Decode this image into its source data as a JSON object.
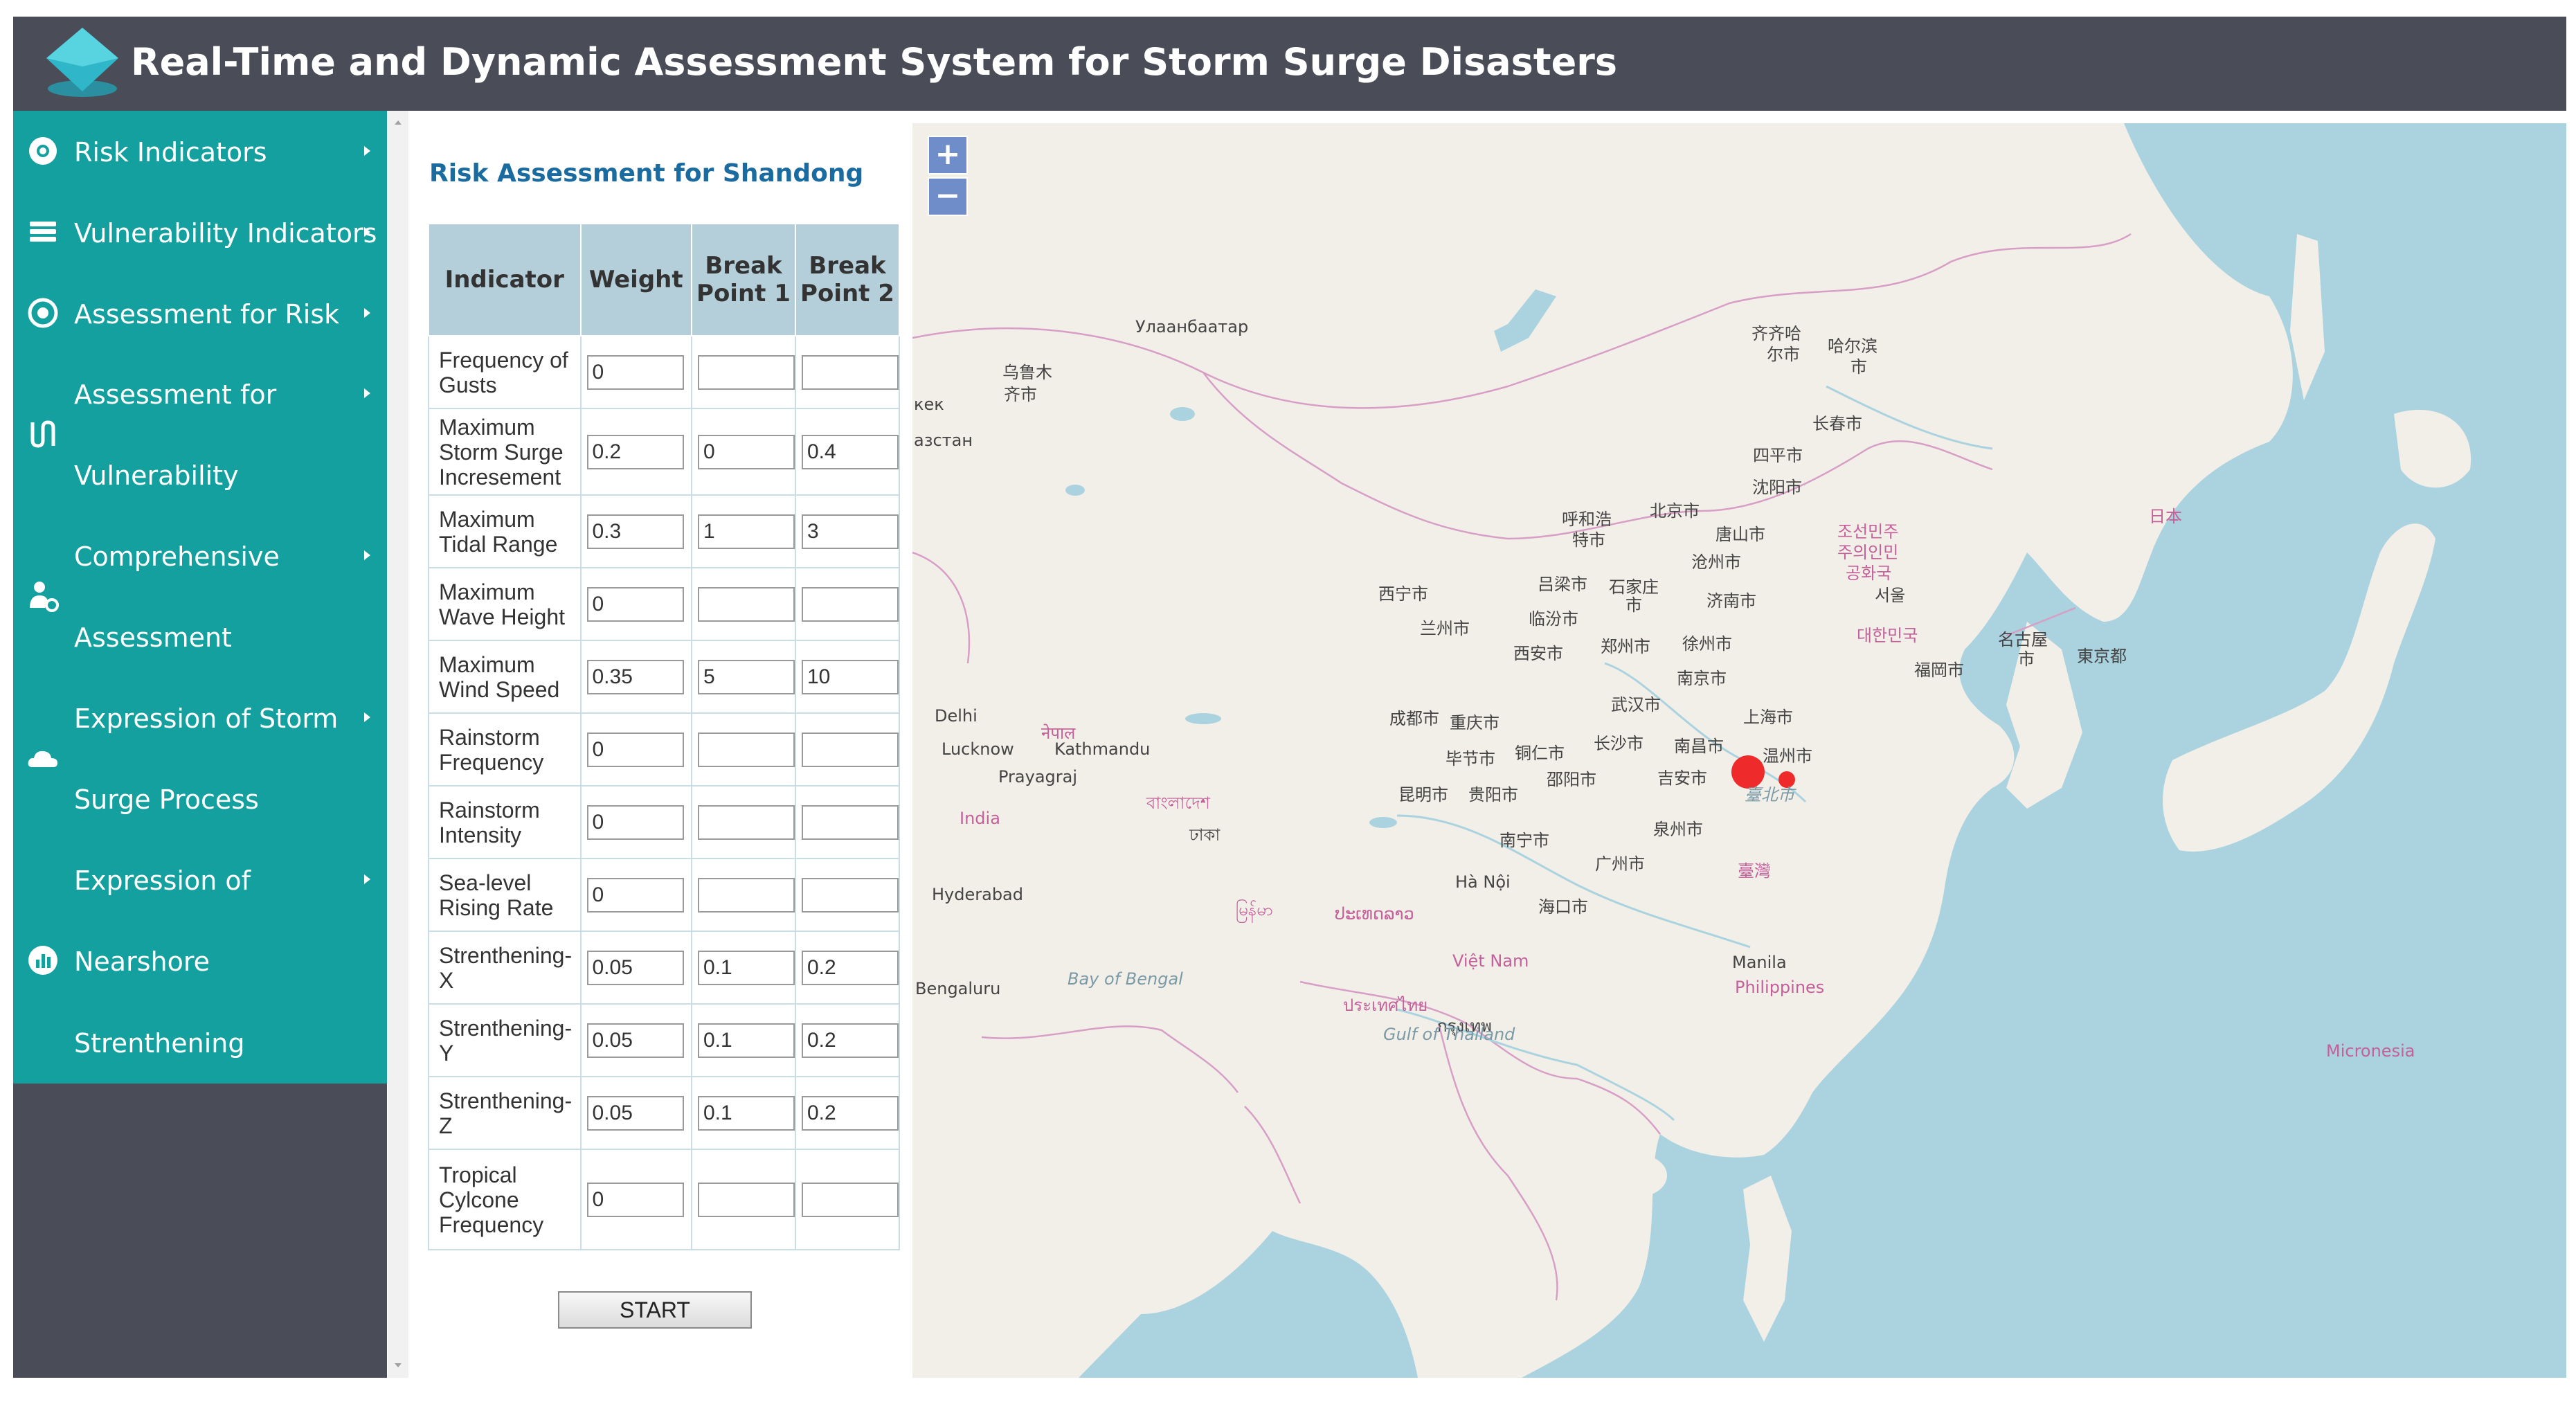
{
  "header": {
    "title": "Real-Time and Dynamic Assessment System for Storm Surge Disasters"
  },
  "sidebar": {
    "items": [
      {
        "icon": "circle-icon",
        "lines": [
          "Risk Indicators"
        ]
      },
      {
        "icon": "layers-icon",
        "lines": [
          "Vulnerability Indicators"
        ]
      },
      {
        "icon": "target-icon",
        "lines": [
          "Assessment for Risk"
        ]
      },
      {
        "icon": "path-icon",
        "lines": [
          "Assessment for",
          "Vulnerability"
        ]
      },
      {
        "icon": "user-gear-icon",
        "lines": [
          "Comprehensive",
          "Assessment"
        ]
      },
      {
        "icon": "cloud-icon",
        "lines": [
          "Expression of Storm",
          "Surge Process"
        ]
      },
      {
        "icon": "chart-icon",
        "lines": [
          "Expression of",
          "Nearshore",
          "Strenthening"
        ]
      }
    ]
  },
  "panel": {
    "title": "Risk Assessment for Shandong",
    "columns": [
      "Indicator",
      "Weight",
      "Break Point 1",
      "Break Point 2"
    ],
    "rows": [
      {
        "name": "Frequency of Gusts",
        "weight": "0",
        "bp1": "",
        "bp2": ""
      },
      {
        "name": "Maximum Storm Surge Incresement",
        "weight": "0.2",
        "bp1": "0",
        "bp2": "0.4"
      },
      {
        "name": "Maximum Tidal Range",
        "weight": "0.3",
        "bp1": "1",
        "bp2": "3"
      },
      {
        "name": "Maximum Wave Height",
        "weight": "0",
        "bp1": "",
        "bp2": ""
      },
      {
        "name": "Maximum Wind Speed",
        "weight": "0.35",
        "bp1": "5",
        "bp2": "10"
      },
      {
        "name": "Rainstorm Frequency",
        "weight": "0",
        "bp1": "",
        "bp2": ""
      },
      {
        "name": "Rainstorm Intensity",
        "weight": "0",
        "bp1": "",
        "bp2": ""
      },
      {
        "name": "Sea-level Rising Rate",
        "weight": "0",
        "bp1": "",
        "bp2": ""
      },
      {
        "name": "Strenthening-X",
        "weight": "0.05",
        "bp1": "0.1",
        "bp2": "0.2"
      },
      {
        "name": "Strenthening-Y",
        "weight": "0.05",
        "bp1": "0.1",
        "bp2": "0.2"
      },
      {
        "name": "Strenthening-Z",
        "weight": "0.05",
        "bp1": "0.1",
        "bp2": "0.2"
      },
      {
        "name": "Tropical Cylcone Frequency",
        "weight": "0",
        "bp1": "",
        "bp2": ""
      }
    ],
    "start_label": "START"
  },
  "map": {
    "zoom_in": "+",
    "zoom_out": "−",
    "labels": [
      {
        "t": "Улаанбаатар"
      },
      {
        "t": "乌鲁木"
      },
      {
        "t": "齐市"
      },
      {
        "t": "齐齐哈"
      },
      {
        "t": "尔市"
      },
      {
        "t": "哈尔滨"
      },
      {
        "t": "市"
      },
      {
        "t": "长春市"
      },
      {
        "t": "四平市"
      },
      {
        "t": "沈阳市"
      },
      {
        "t": "北京市"
      },
      {
        "t": "呼和浩"
      },
      {
        "t": "特市"
      },
      {
        "t": "唐山市"
      },
      {
        "t": "沧州市"
      },
      {
        "t": "吕梁市"
      },
      {
        "t": "石家庄"
      },
      {
        "t": "市"
      },
      {
        "t": "济南市"
      },
      {
        "t": "临汾市"
      },
      {
        "t": "西宁市"
      },
      {
        "t": "兰州市"
      },
      {
        "t": "西安市"
      },
      {
        "t": "郑州市"
      },
      {
        "t": "徐州市"
      },
      {
        "t": "南京市"
      },
      {
        "t": "武汉市"
      },
      {
        "t": "上海市"
      },
      {
        "t": "成都市"
      },
      {
        "t": "重庆市"
      },
      {
        "t": "长沙市"
      },
      {
        "t": "南昌市"
      },
      {
        "t": "毕节市"
      },
      {
        "t": "铜仁市"
      },
      {
        "t": "温州市"
      },
      {
        "t": "昆明市"
      },
      {
        "t": "贵阳市"
      },
      {
        "t": "邵阳市"
      },
      {
        "t": "吉安市"
      },
      {
        "t": "臺北市"
      },
      {
        "t": "泉州市"
      },
      {
        "t": "南宁市"
      },
      {
        "t": "广州市"
      },
      {
        "t": "臺灣"
      },
      {
        "t": "Hà Nội"
      },
      {
        "t": "海口市"
      },
      {
        "t": "조선민주"
      },
      {
        "t": "주의인민"
      },
      {
        "t": "공화국"
      },
      {
        "t": "서울"
      },
      {
        "t": "대한민국"
      },
      {
        "t": "日本"
      },
      {
        "t": "名古屋"
      },
      {
        "t": "市"
      },
      {
        "t": "東京都"
      },
      {
        "t": "福岡市"
      },
      {
        "t": "Delhi"
      },
      {
        "t": "नेपाल"
      },
      {
        "t": "Lucknow"
      },
      {
        "t": "Kathmandu"
      },
      {
        "t": "Prayagraj"
      },
      {
        "t": "বাংলাদেশ"
      },
      {
        "t": "India"
      },
      {
        "t": "ঢাকা"
      },
      {
        "t": "Hyderabad"
      },
      {
        "t": "မြန်မာ"
      },
      {
        "t": "ປະເທດລາວ"
      },
      {
        "t": "Việt Nam"
      },
      {
        "t": "Manila"
      },
      {
        "t": "Philippines"
      },
      {
        "t": "Bengaluru"
      },
      {
        "t": "Bay of Bengal"
      },
      {
        "t": "ประเทศไทย"
      },
      {
        "t": "กรุงเทพ"
      },
      {
        "t": "Gulf of Thailand"
      },
      {
        "t": "Micronesia"
      },
      {
        "t": "кек"
      },
      {
        "t": "азстан"
      }
    ]
  },
  "colors": {
    "header_bg": "#4a4d57",
    "sidebar_bg": "#13a09e",
    "table_header_bg": "#b4cfda",
    "title_blue": "#1a6ba0",
    "water": "#aad3df",
    "land": "#f2efe9",
    "marker": "#ee2a2a"
  }
}
